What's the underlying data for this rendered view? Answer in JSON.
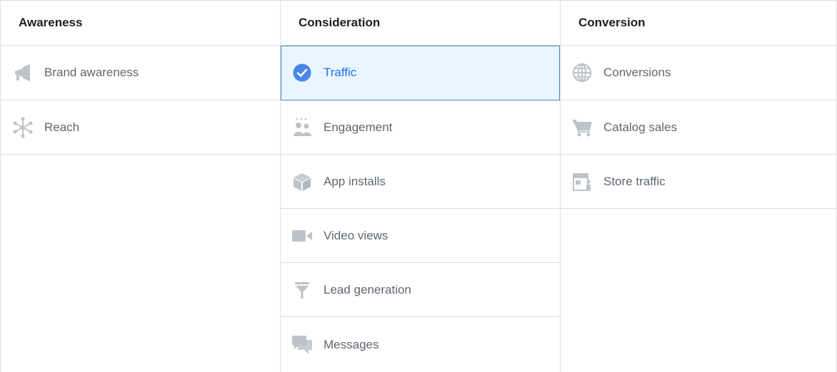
{
  "columns": [
    {
      "header": "Awareness",
      "items": [
        {
          "label": "Brand awareness",
          "icon": "megaphone-icon"
        },
        {
          "label": "Reach",
          "icon": "reach-icon"
        }
      ]
    },
    {
      "header": "Consideration",
      "items": [
        {
          "label": "Traffic",
          "icon": "check-circle-icon",
          "selected": true
        },
        {
          "label": "Engagement",
          "icon": "people-icon"
        },
        {
          "label": "App installs",
          "icon": "box-icon"
        },
        {
          "label": "Video views",
          "icon": "video-camera-icon"
        },
        {
          "label": "Lead generation",
          "icon": "funnel-icon"
        },
        {
          "label": "Messages",
          "icon": "chat-bubbles-icon"
        }
      ]
    },
    {
      "header": "Conversion",
      "items": [
        {
          "label": "Conversions",
          "icon": "globe-icon"
        },
        {
          "label": "Catalog sales",
          "icon": "shopping-cart-icon"
        },
        {
          "label": "Store traffic",
          "icon": "store-icon"
        }
      ]
    }
  ],
  "colors": {
    "icon": "#bec3c9",
    "selected_bg": "#ebf5fd",
    "selected_border": "#4a86c5",
    "selected_text": "#1877f2",
    "check": "#4a86e8",
    "border": "#dddfe2"
  }
}
